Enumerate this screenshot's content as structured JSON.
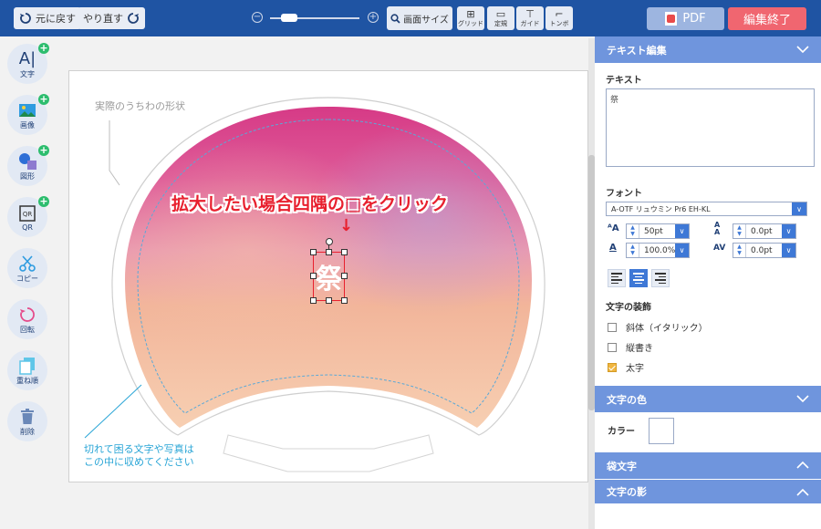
{
  "toolbar": {
    "undo_label": "元に戻す",
    "redo_label": "やり直す",
    "fit_label": "画面サイズ",
    "grid_label": "グリッド",
    "ruler_label": "定規",
    "guide_label": "ガイド",
    "trim_label": "トンボ",
    "pdf_label": "PDF",
    "finish_label": "編集終了"
  },
  "tools": [
    {
      "label": "文字",
      "icon": "text-icon"
    },
    {
      "label": "画像",
      "icon": "image-icon"
    },
    {
      "label": "図形",
      "icon": "shape-icon"
    },
    {
      "label": "QR",
      "icon": "qr-icon"
    },
    {
      "label": "コピー",
      "icon": "scissors-icon"
    },
    {
      "label": "回転",
      "icon": "rotate-icon"
    },
    {
      "label": "重ね順",
      "icon": "layer-order-icon"
    },
    {
      "label": "削除",
      "icon": "trash-icon"
    }
  ],
  "canvas": {
    "shape_note": "実際のうちわの形状",
    "hint": "拡大したい場合四隅の□をクリック",
    "hint_arrow": "↓",
    "selected_text": "祭",
    "safe_note_line1": "切れて困る文字や写真は",
    "safe_note_line2": "この中に収めてください"
  },
  "panel": {
    "text_edit_title": "テキスト編集",
    "text_label": "テキスト",
    "text_value": "祭",
    "font_label": "フォント",
    "font_value": "A-OTF リュウミン Pr6 EH-KL",
    "font_size": "50pt",
    "line_spacing": "0.0pt",
    "scale": "100.0%",
    "letter_spacing": "0.0pt",
    "decoration_label": "文字の装飾",
    "italic_label": "斜体（イタリック）",
    "vertical_label": "縦書き",
    "bold_label": "太字",
    "italic_checked": false,
    "vertical_checked": false,
    "bold_checked": true,
    "text_color_title": "文字の色",
    "color_label": "カラー",
    "color_value": "#ffffff",
    "outline_title": "袋文字",
    "shadow_title": "文字の影"
  },
  "colors": {
    "topbar": "#1f54a3",
    "section_header": "#6f95dd",
    "finish_button": "#f06670",
    "hint_text": "#e8202e",
    "safe_note": "#29a5d6"
  }
}
